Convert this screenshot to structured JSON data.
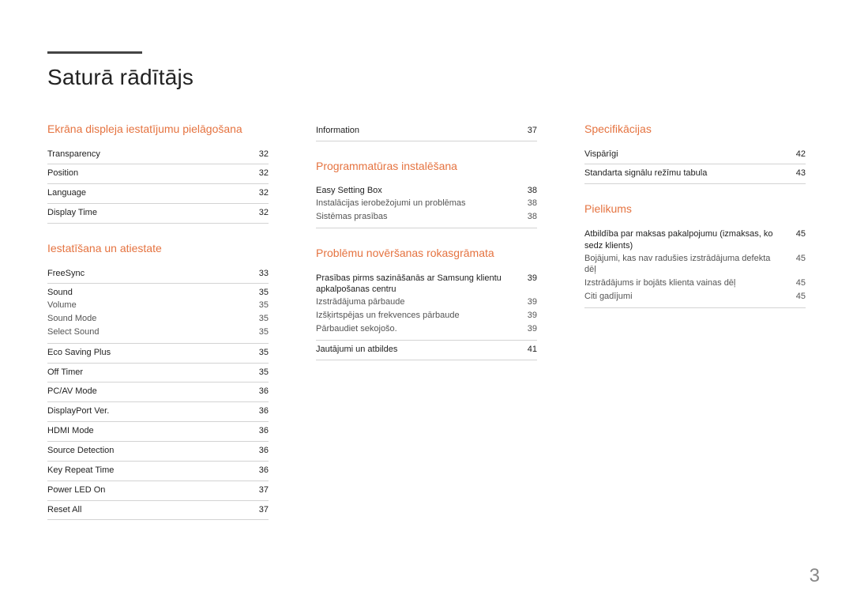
{
  "title": "Saturā rādītājs",
  "page_number": "3",
  "col1": {
    "sec1": {
      "heading": "Ekrāna displeja iestatījumu pielāgošana",
      "items": [
        {
          "label": "Transparency",
          "page": "32"
        },
        {
          "label": "Position",
          "page": "32"
        },
        {
          "label": "Language",
          "page": "32"
        },
        {
          "label": "Display Time",
          "page": "32"
        }
      ]
    },
    "sec2": {
      "heading": "Iestatīšana un atiestate",
      "freesync": {
        "label": "FreeSync",
        "page": "33"
      },
      "sound": {
        "label": "Sound",
        "page": "35",
        "subs": [
          {
            "label": "Volume",
            "page": "35"
          },
          {
            "label": "Sound Mode",
            "page": "35"
          },
          {
            "label": "Select Sound",
            "page": "35"
          }
        ]
      },
      "rest": [
        {
          "label": "Eco Saving Plus",
          "page": "35"
        },
        {
          "label": "Off Timer",
          "page": "35"
        },
        {
          "label": "PC/AV Mode",
          "page": "36"
        },
        {
          "label": "DisplayPort Ver.",
          "page": "36"
        },
        {
          "label": "HDMI Mode",
          "page": "36"
        },
        {
          "label": "Source Detection",
          "page": "36"
        },
        {
          "label": "Key Repeat Time",
          "page": "36"
        },
        {
          "label": "Power LED On",
          "page": "37"
        },
        {
          "label": "Reset All",
          "page": "37"
        }
      ]
    }
  },
  "col2": {
    "top": {
      "label": "Information",
      "page": "37"
    },
    "sec1": {
      "heading": "Programmatūras instalēšana",
      "easy": {
        "label": "Easy Setting Box",
        "page": "38",
        "subs": [
          {
            "label": "Instalācijas ierobežojumi un problēmas",
            "page": "38"
          },
          {
            "label": "Sistēmas prasības",
            "page": "38"
          }
        ]
      }
    },
    "sec2": {
      "heading": "Problēmu novēršanas rokasgrāmata",
      "req": {
        "label": "Prasības pirms sazināšanās ar Samsung klientu apkalpošanas centru",
        "page": "39",
        "subs": [
          {
            "label": "Izstrādājuma pārbaude",
            "page": "39"
          },
          {
            "label": "Izšķirtspējas un frekvences pārbaude",
            "page": "39"
          },
          {
            "label": "Pārbaudiet sekojošo.",
            "page": "39"
          }
        ]
      },
      "qa": {
        "label": "Jautājumi un atbildes",
        "page": "41"
      }
    }
  },
  "col3": {
    "sec1": {
      "heading": "Specifikācijas",
      "items": [
        {
          "label": "Vispārīgi",
          "page": "42"
        },
        {
          "label": "Standarta signālu režīmu tabula",
          "page": "43"
        }
      ]
    },
    "sec2": {
      "heading": "Pielikums",
      "liab": {
        "label": "Atbildība par maksas pakalpojumu (izmaksas, ko sedz klients)",
        "page": "45",
        "subs": [
          {
            "label": "Bojājumi, kas nav radušies izstrādājuma defekta dēļ",
            "page": "45"
          },
          {
            "label": "Izstrādājums ir bojāts klienta vainas dēļ",
            "page": "45"
          },
          {
            "label": "Citi gadījumi",
            "page": "45"
          }
        ]
      }
    }
  }
}
